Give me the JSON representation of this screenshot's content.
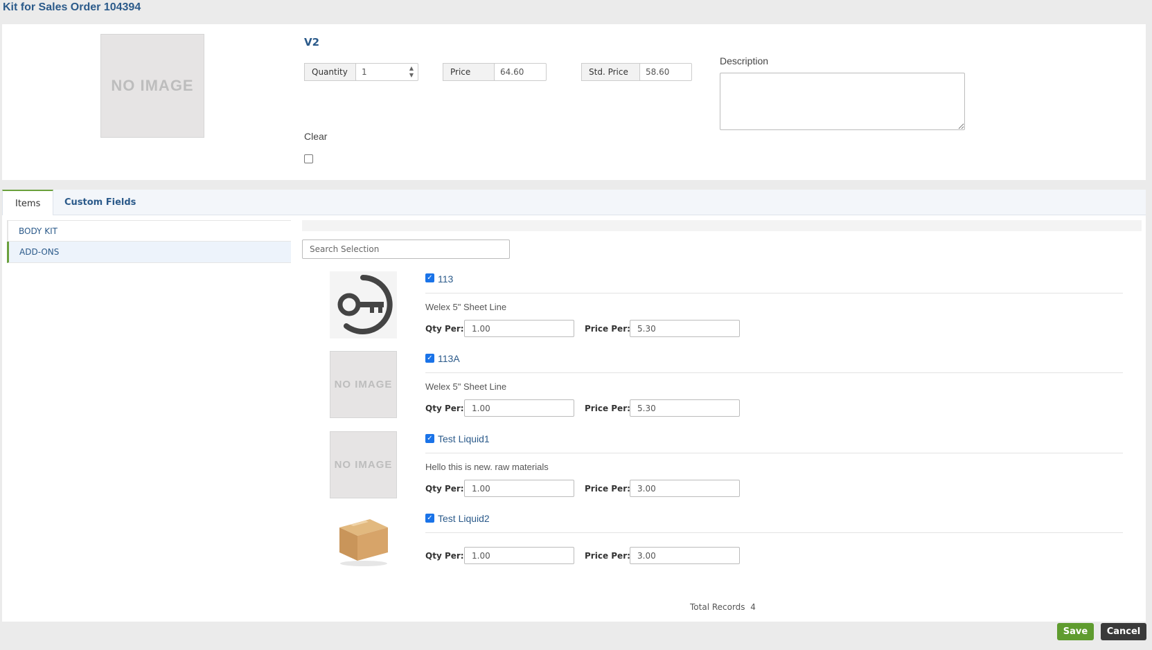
{
  "page": {
    "title": "Kit for Sales Order 104394"
  },
  "kit": {
    "image_text": "NO IMAGE",
    "name": "V2",
    "quantity_label": "Quantity",
    "quantity_value": "1",
    "price_label": "Price",
    "price_value": "64.60",
    "std_price_label": "Std. Price",
    "std_price_value": "58.60",
    "description_label": "Description",
    "description_value": "",
    "clear_label": "Clear",
    "clear_checked": false
  },
  "tabs": [
    {
      "label": "Items",
      "active": true
    },
    {
      "label": "Custom Fields",
      "active": false
    }
  ],
  "sidebar": {
    "items": [
      {
        "label": "BODY KIT",
        "selected": false
      },
      {
        "label": "ADD-ONS",
        "selected": true
      }
    ]
  },
  "search": {
    "placeholder": "Search Selection"
  },
  "items": [
    {
      "name": "113",
      "checked": true,
      "image": "key-icon",
      "description": "Welex 5\" Sheet Line",
      "qty_label": "Qty Per:",
      "qty": "1.00",
      "price_label": "Price Per:",
      "price": "5.30"
    },
    {
      "name": "113A",
      "checked": true,
      "image": "NO IMAGE",
      "description": "Welex 5\" Sheet Line",
      "qty_label": "Qty Per:",
      "qty": "1.00",
      "price_label": "Price Per:",
      "price": "5.30"
    },
    {
      "name": "Test Liquid1",
      "checked": true,
      "image": "NO IMAGE",
      "description": "Hello this is new. raw materials",
      "qty_label": "Qty Per:",
      "qty": "1.00",
      "price_label": "Price Per:",
      "price": "3.00"
    },
    {
      "name": "Test Liquid2",
      "checked": true,
      "image": "box-icon",
      "description": "",
      "qty_label": "Qty Per:",
      "qty": "1.00",
      "price_label": "Price Per:",
      "price": "3.00"
    }
  ],
  "footer": {
    "total_label": "Total Records",
    "total_value": "4",
    "save_label": "Save",
    "cancel_label": "Cancel"
  },
  "colors": {
    "accent": "#2b5a8a",
    "green": "#5f9c2f",
    "dark": "#3a3a3a"
  }
}
